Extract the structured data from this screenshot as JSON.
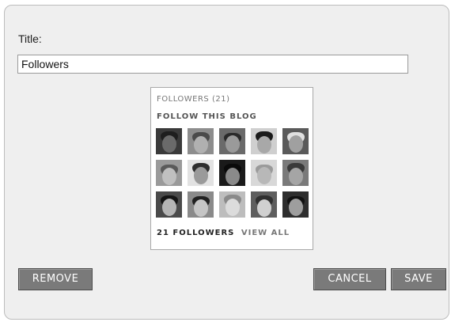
{
  "form": {
    "title_label": "Title:",
    "title_value": "Followers"
  },
  "widget": {
    "heading": "FOLLOWERS (21)",
    "follow_link": "FOLLOW THIS BLOG",
    "footer_count": "21 FOLLOWERS",
    "footer_view_all": "VIEW ALL",
    "avatars": [
      {
        "bg": "#3a3a3a",
        "face": "#6a6a6a",
        "hair": "#1e1e1e"
      },
      {
        "bg": "#8d8d8d",
        "face": "#b0b0b0",
        "hair": "#4a4a4a"
      },
      {
        "bg": "#6a6a6a",
        "face": "#9a9a9a",
        "hair": "#2a2a2a"
      },
      {
        "bg": "#cfcfcf",
        "face": "#a8a8a8",
        "hair": "#1a1a1a"
      },
      {
        "bg": "#5a5a5a",
        "face": "#a0a0a0",
        "hair": "#e0e0e0"
      },
      {
        "bg": "#9a9a9a",
        "face": "#c0c0c0",
        "hair": "#5a5a5a"
      },
      {
        "bg": "#e2e2e2",
        "face": "#9a9a9a",
        "hair": "#2e2e2e"
      },
      {
        "bg": "#1a1a1a",
        "face": "#8a8a8a",
        "hair": "#0a0a0a"
      },
      {
        "bg": "#d8d8d8",
        "face": "#b8b8b8",
        "hair": "#9a9a9a"
      },
      {
        "bg": "#7a7a7a",
        "face": "#a5a5a5",
        "hair": "#3a3a3a"
      },
      {
        "bg": "#4a4a4a",
        "face": "#b5b5b5",
        "hair": "#151515"
      },
      {
        "bg": "#8a8a8a",
        "face": "#c5c5c5",
        "hair": "#202020"
      },
      {
        "bg": "#bdbdbd",
        "face": "#dcdcdc",
        "hair": "#8a8a8a"
      },
      {
        "bg": "#5e5e5e",
        "face": "#d0d0d0",
        "hair": "#303030"
      },
      {
        "bg": "#2e2e2e",
        "face": "#9e9e9e",
        "hair": "#111111"
      }
    ]
  },
  "buttons": {
    "remove": "REMOVE",
    "cancel": "CANCEL",
    "save": "SAVE"
  },
  "colors": {
    "dialog_bg": "#efefef",
    "button_bg": "#7a7a7a",
    "button_text": "#ffffff"
  }
}
